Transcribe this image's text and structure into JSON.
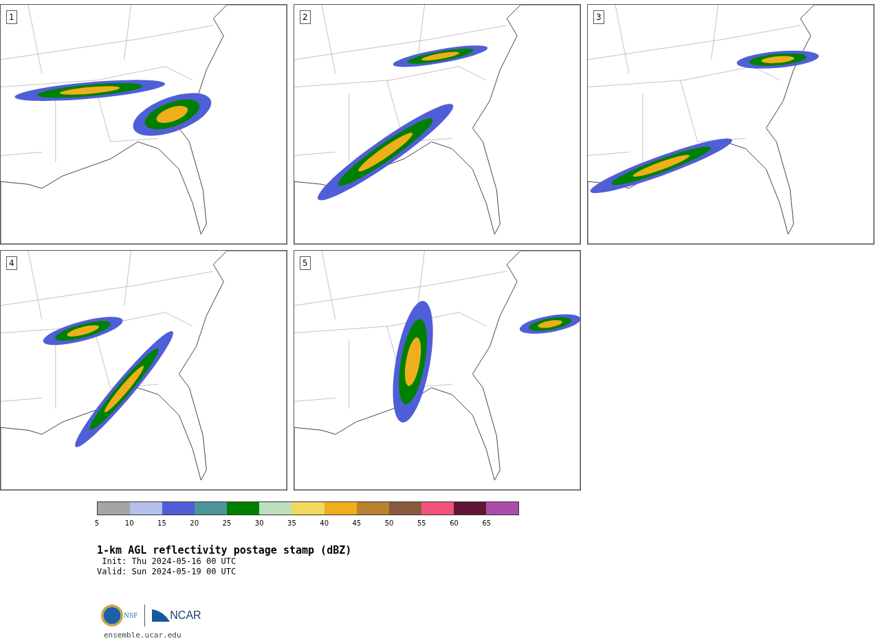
{
  "panels": [
    {
      "label": "1"
    },
    {
      "label": "2"
    },
    {
      "label": "3"
    },
    {
      "label": "4"
    },
    {
      "label": "5"
    }
  ],
  "colorbar": {
    "segments": [
      {
        "color": "#a5a5a5"
      },
      {
        "color": "#b4bfeb"
      },
      {
        "color": "#505ed7"
      },
      {
        "color": "#4d9499"
      },
      {
        "color": "#008000"
      },
      {
        "color": "#bedfbe"
      },
      {
        "color": "#f0d95e"
      },
      {
        "color": "#f0ae1c"
      },
      {
        "color": "#b8822f"
      },
      {
        "color": "#8a5a3e"
      },
      {
        "color": "#f2537c"
      },
      {
        "color": "#5e1735"
      },
      {
        "color": "#aa4ca8"
      }
    ],
    "ticks": [
      "5",
      "10",
      "15",
      "20",
      "25",
      "30",
      "35",
      "40",
      "45",
      "50",
      "55",
      "60",
      "65"
    ]
  },
  "title": "1-km AGL reflectivity postage stamp (dBZ)",
  "init": " Init: Thu 2024-05-16 00 UTC",
  "valid": "Valid: Sun 2024-05-19 00 UTC",
  "logo": {
    "left": "NSF",
    "right": "NCAR"
  },
  "footer": "ensemble.ucar.edu"
}
